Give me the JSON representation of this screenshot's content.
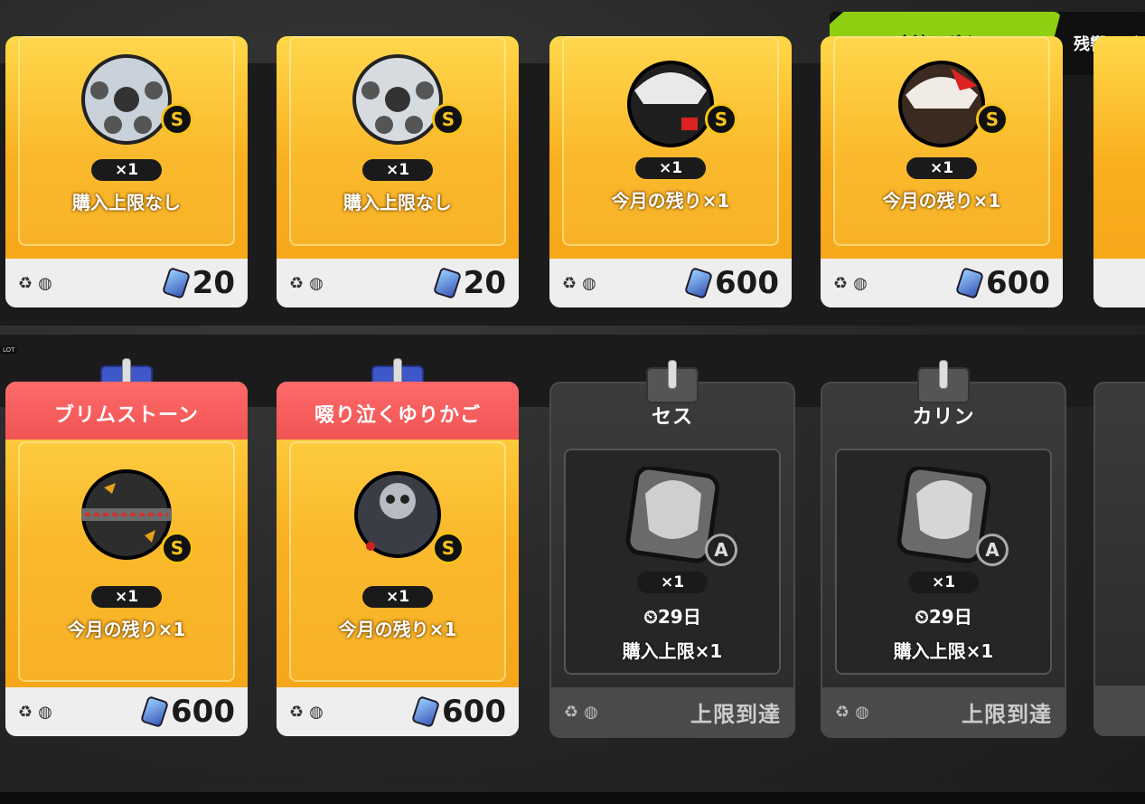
{
  "tabs": {
    "active": "余波シグナル",
    "inactive": "残響シグ"
  },
  "side_label": "LOT",
  "top_row": [
    {
      "qty": "×1",
      "limit": "購入上限なし",
      "price": "20",
      "badge": "S"
    },
    {
      "qty": "×1",
      "limit": "購入上限なし",
      "price": "20",
      "badge": "S"
    },
    {
      "qty": "×1",
      "limit": "今月の残り×1",
      "price": "600",
      "badge": "S"
    },
    {
      "qty": "×1",
      "limit": "今月の残り×1",
      "price": "600",
      "badge": "S"
    }
  ],
  "bottom_row": [
    {
      "title": "ブリムストーン",
      "qty": "×1",
      "limit": "今月の残り×1",
      "price": "600",
      "badge": "S"
    },
    {
      "title": "啜り泣くゆりかご",
      "qty": "×1",
      "limit": "今月の残り×1",
      "price": "600",
      "badge": "S"
    },
    {
      "title": "セス",
      "qty": "×1",
      "timer": "29日",
      "limit": "購入上限×1",
      "status": "上限到達",
      "badge": "A"
    },
    {
      "title": "カリン",
      "qty": "×1",
      "timer": "29日",
      "limit": "購入上限×1",
      "status": "上限到達",
      "badge": "A"
    }
  ],
  "icons": {
    "recycle": "♻",
    "coin": "◍",
    "clock": "⏲",
    "ticket": "ticket-icon"
  },
  "colors": {
    "tab_active": "#8fcf12",
    "gold_card": "#f9b020",
    "red_title": "#f05454",
    "clip_blue": "#3e57c9"
  }
}
